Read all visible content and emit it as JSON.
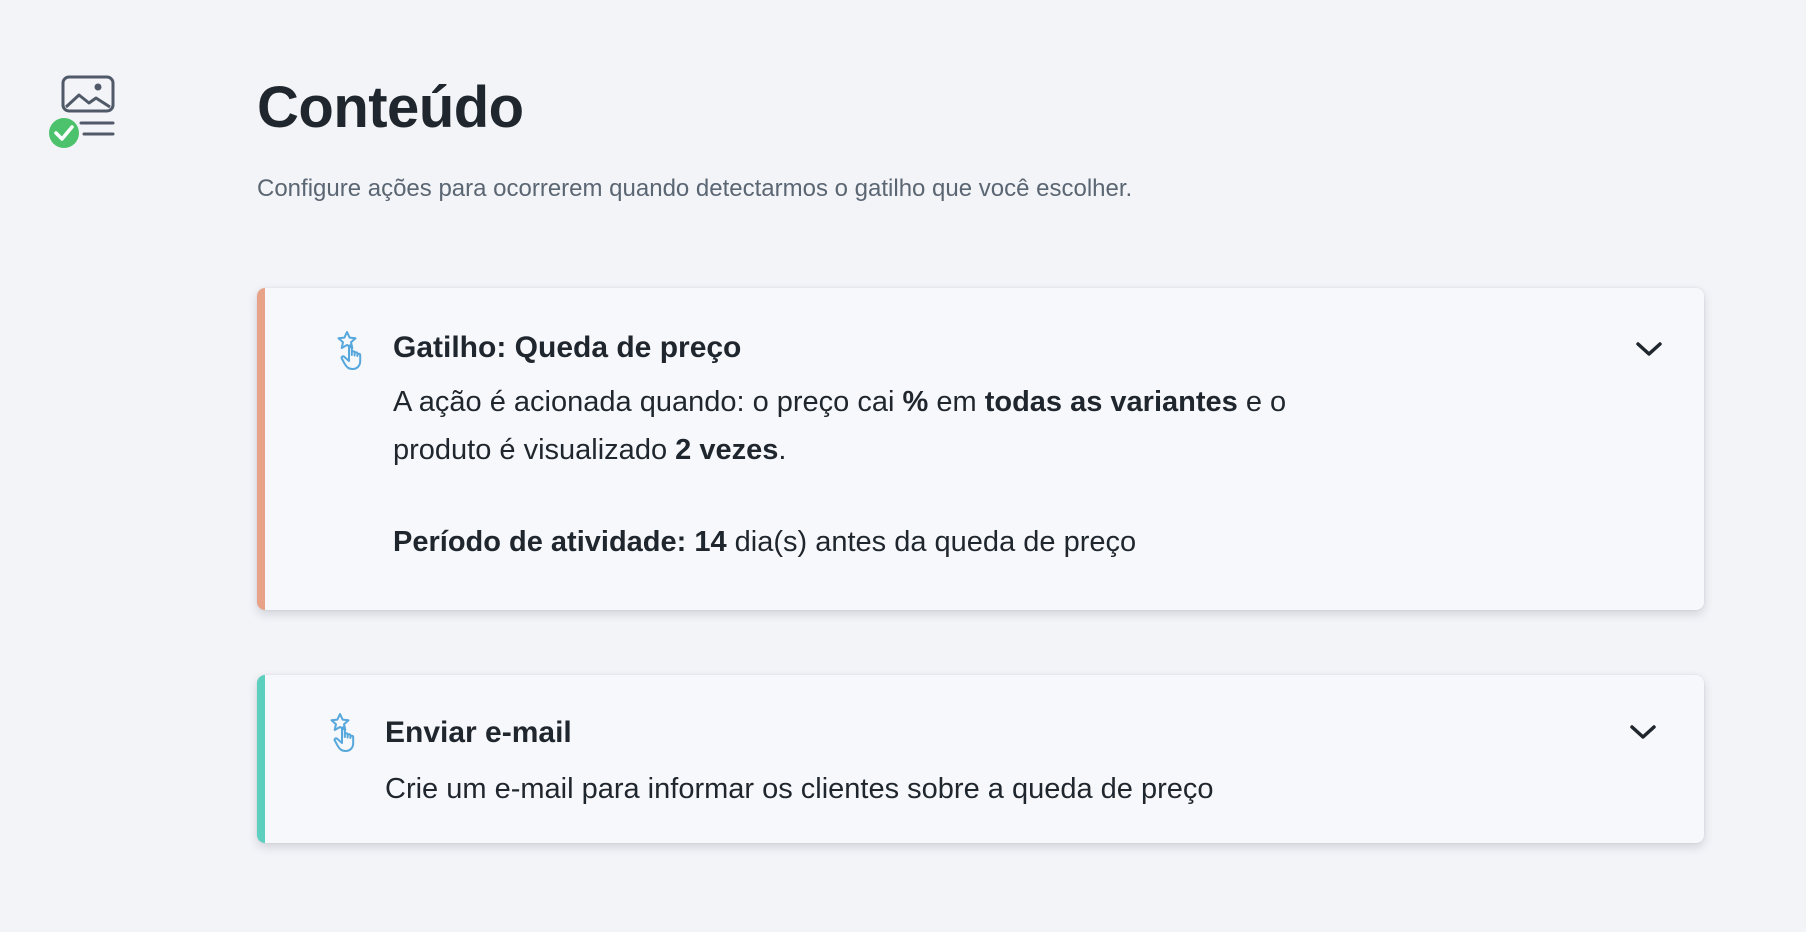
{
  "header": {
    "title": "Conteúdo",
    "subtitle": "Configure ações para ocorrerem quando detectarmos o gatilho que você escolher."
  },
  "section_icon": "content-image-check-icon",
  "trigger_card": {
    "icon": "pointer-star-icon",
    "title": "Gatilho: Queda de preço",
    "text_prefix": "A ação é acionada quando: o preço cai ",
    "percent": "%",
    "text_mid1": " em ",
    "variants": "todas as variantes",
    "text_mid2": " e o produto é visualizado ",
    "views": "2 vezes",
    "text_end": ".",
    "period_label": "Período de atividade: 14",
    "period_text": " dia(s) antes da queda de preço",
    "accent_color": "#e8a287",
    "chevron_icon": "chevron-down-icon"
  },
  "email_card": {
    "icon": "pointer-star-icon",
    "title": "Enviar e-mail",
    "text": "Crie um e-mail para informar os clientes sobre a queda de preço",
    "accent_color": "#5ccfbf",
    "chevron_icon": "chevron-down-icon"
  },
  "colors": {
    "background": "#f3f4f8",
    "check_green": "#4cc26c",
    "icon_blue": "#55a7dc",
    "icon_gray": "#4f5967"
  }
}
